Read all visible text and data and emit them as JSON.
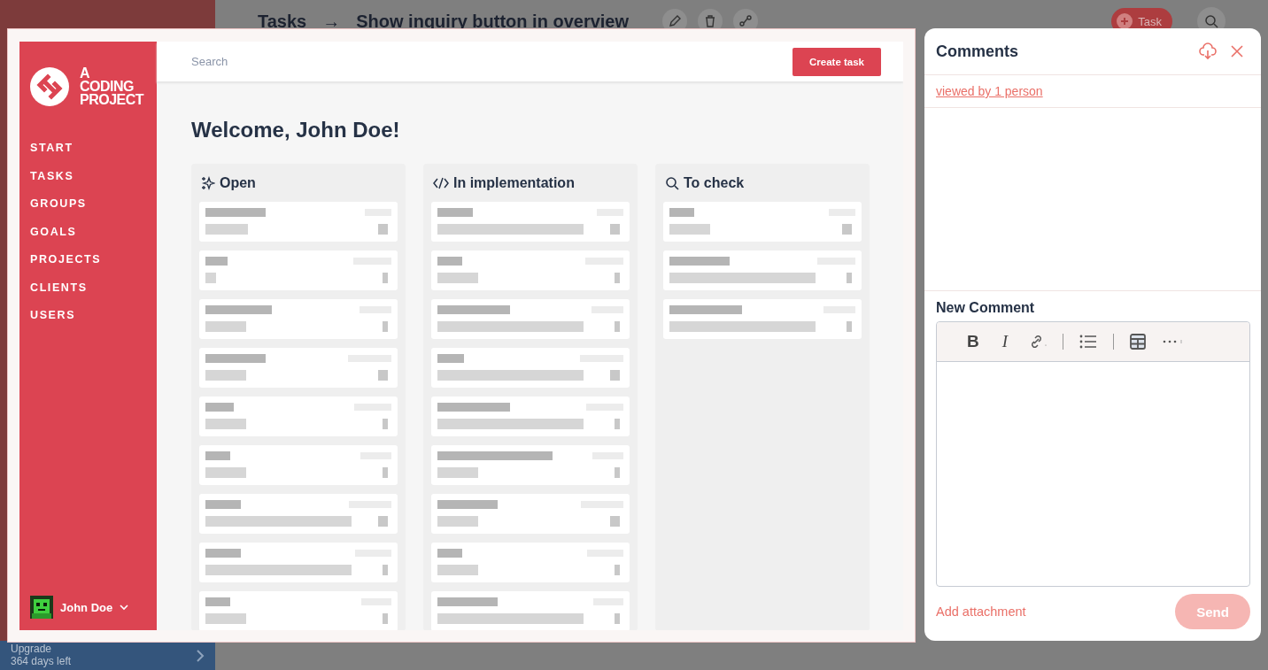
{
  "background_app": {
    "header": {
      "breadcrumb": "Tasks",
      "separator": "→",
      "title": "Show inquiry button in overview",
      "task_button": "Task"
    },
    "upgrade": {
      "title": "Upgrade",
      "subtitle": "364 days left"
    }
  },
  "preview": {
    "logo_text": "A CODING PROJECT",
    "nav": [
      {
        "label": "START"
      },
      {
        "label": "TASKS"
      },
      {
        "label": "GROUPS"
      },
      {
        "label": "GOALS"
      },
      {
        "label": "PROJECTS"
      },
      {
        "label": "CLIENTS"
      },
      {
        "label": "USERS"
      }
    ],
    "user": "John Doe",
    "search_placeholder": "Search",
    "create_button": "Create task",
    "welcome": "Welcome, John Doe!",
    "columns": [
      {
        "kind": "open",
        "title": "Open",
        "cards": [
          {
            "kind": "skeleton"
          },
          {
            "kind": "skeleton"
          },
          {
            "kind": "skeleton"
          },
          {
            "kind": "skeleton"
          },
          {
            "kind": "skeleton"
          },
          {
            "kind": "skeleton"
          },
          {
            "kind": "skeleton"
          },
          {
            "kind": "skeleton"
          },
          {
            "kind": "skeleton"
          }
        ]
      },
      {
        "kind": "implementation",
        "title": "In implementation",
        "cards": [
          {
            "kind": "skeleton"
          },
          {
            "kind": "skeleton"
          },
          {
            "kind": "skeleton"
          },
          {
            "kind": "skeleton"
          },
          {
            "kind": "skeleton"
          },
          {
            "kind": "skeleton"
          },
          {
            "kind": "skeleton"
          },
          {
            "kind": "skeleton"
          },
          {
            "kind": "skeleton"
          }
        ]
      },
      {
        "kind": "check",
        "title": "To check",
        "cards": [
          {
            "kind": "skeleton"
          },
          {
            "kind": "skeleton"
          },
          {
            "kind": "skeleton"
          }
        ]
      }
    ]
  },
  "comments": {
    "title": "Comments",
    "viewed_by": "viewed by 1 person",
    "new_comment_label": "New Comment",
    "toolbar": [
      {
        "kind": "bold",
        "label": "B"
      },
      {
        "kind": "italic",
        "label": "I"
      },
      {
        "kind": "link"
      },
      {
        "kind": "separator"
      },
      {
        "kind": "list"
      },
      {
        "kind": "separator"
      },
      {
        "kind": "table"
      },
      {
        "kind": "more"
      }
    ],
    "add_attachment": "Add attachment",
    "send": {
      "label": "Send",
      "disabled": true
    }
  }
}
